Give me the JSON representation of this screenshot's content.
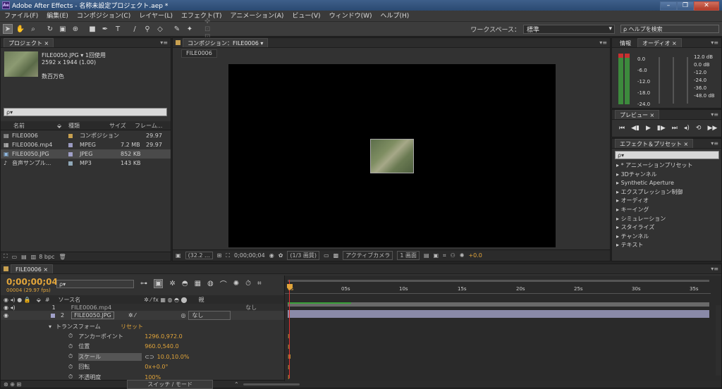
{
  "title": "Adobe After Effects - 名称未設定プロジェクト.aep *",
  "app_icon": "Ae",
  "menus": [
    "ファイル(F)",
    "編集(E)",
    "コンポジション(C)",
    "レイヤー(L)",
    "エフェクト(T)",
    "アニメーション(A)",
    "ビュー(V)",
    "ウィンドウ(W)",
    "ヘルプ(H)"
  ],
  "workspace": {
    "label": "ワークスペース：",
    "value": "標準",
    "help_placeholder": "ヘルプを検索"
  },
  "project": {
    "tab": "プロジェクト",
    "file_name": "FILE0050.JPG ▾",
    "used": "1回使用",
    "dims": "2592 x 1944 (1.00)",
    "colors": "数百万色",
    "search_placeholder": "ρ▾",
    "headers": [
      "名前",
      "種類",
      "サイズ",
      "フレーム..."
    ],
    "rows": [
      {
        "name": "FILE0006",
        "type": "コンポジション",
        "size": "",
        "fps": "29.97",
        "swatch": "#c8a050",
        "icon": "comp-icon"
      },
      {
        "name": "FILE0006.mp4",
        "type": "MPEG",
        "size": "7.2 MB",
        "fps": "29.97",
        "swatch": "#9a9ac0",
        "icon": "video-icon"
      },
      {
        "name": "FILE0050.JPG",
        "type": "JPEG",
        "size": "852 KB",
        "fps": "",
        "swatch": "#a0a0c8",
        "icon": "image-icon"
      },
      {
        "name": "音声サンプル...",
        "type": "MP3",
        "size": "143 KB",
        "fps": "",
        "swatch": "#90a8b8",
        "icon": "audio-icon"
      }
    ],
    "bpc": "8 bpc"
  },
  "comp": {
    "tab": "コンポジション：FILE0006",
    "subtab": "FILE0006",
    "zoom": "(32.2 ...",
    "timecode": "0;00;00;04",
    "res": "(1/3 画質)",
    "camera": "アクティブカメラ",
    "views": "1 画面",
    "exposure": "+0.0"
  },
  "info": {
    "tab1": "情報",
    "tab2": "オーディオ",
    "db_left": [
      "0.0",
      "-6.0",
      "-12.0",
      "-18.0",
      "-24.0"
    ],
    "db_right": [
      "12.0 dB",
      "0.0 dB",
      "-12.0",
      "-24.0",
      "-36.0",
      "-48.0 dB"
    ]
  },
  "preview": {
    "tab": "プレビュー"
  },
  "effects": {
    "tab": "エフェクト＆プリセット",
    "search_placeholder": "ρ▾",
    "items": [
      "* アニメーションプリセット",
      "3Dチャンネル",
      "Synthetic Aperture",
      "エクスプレッション制御",
      "オーディオ",
      "キーイング",
      "シミュレーション",
      "スタイライズ",
      "チャンネル",
      "テキスト"
    ]
  },
  "timeline": {
    "tab": "FILE0006",
    "timecode": "0;00;00;04",
    "frame_info": "00004 (29.97 fps)",
    "search_placeholder": "ρ▾",
    "col_source": "ソース名",
    "col_parent": "親",
    "ruler": [
      "0s",
      "05s",
      "10s",
      "15s",
      "20s",
      "25s",
      "30s",
      "35s"
    ],
    "layers": [
      {
        "num": "1",
        "name": "FILE0006.mp4",
        "parent": "なし"
      },
      {
        "num": "2",
        "name": "FILE0050.JPG",
        "parent": "なし"
      }
    ],
    "transform": "トランスフォーム",
    "reset": "リセット",
    "props": [
      {
        "label": "アンカーポイント",
        "value": "1296.0,972.0"
      },
      {
        "label": "位置",
        "value": "960.0,540.0"
      },
      {
        "label": "スケール",
        "value": "10.0,10.0%"
      },
      {
        "label": "回転",
        "value": "0x+0.0°"
      },
      {
        "label": "不透明度",
        "value": "100%"
      }
    ],
    "switch_mode": "スイッチ / モード"
  },
  "colors": {
    "accent": "#e2a53a",
    "playhead": "#e03030",
    "layer_bar": "#8a8aa8"
  }
}
